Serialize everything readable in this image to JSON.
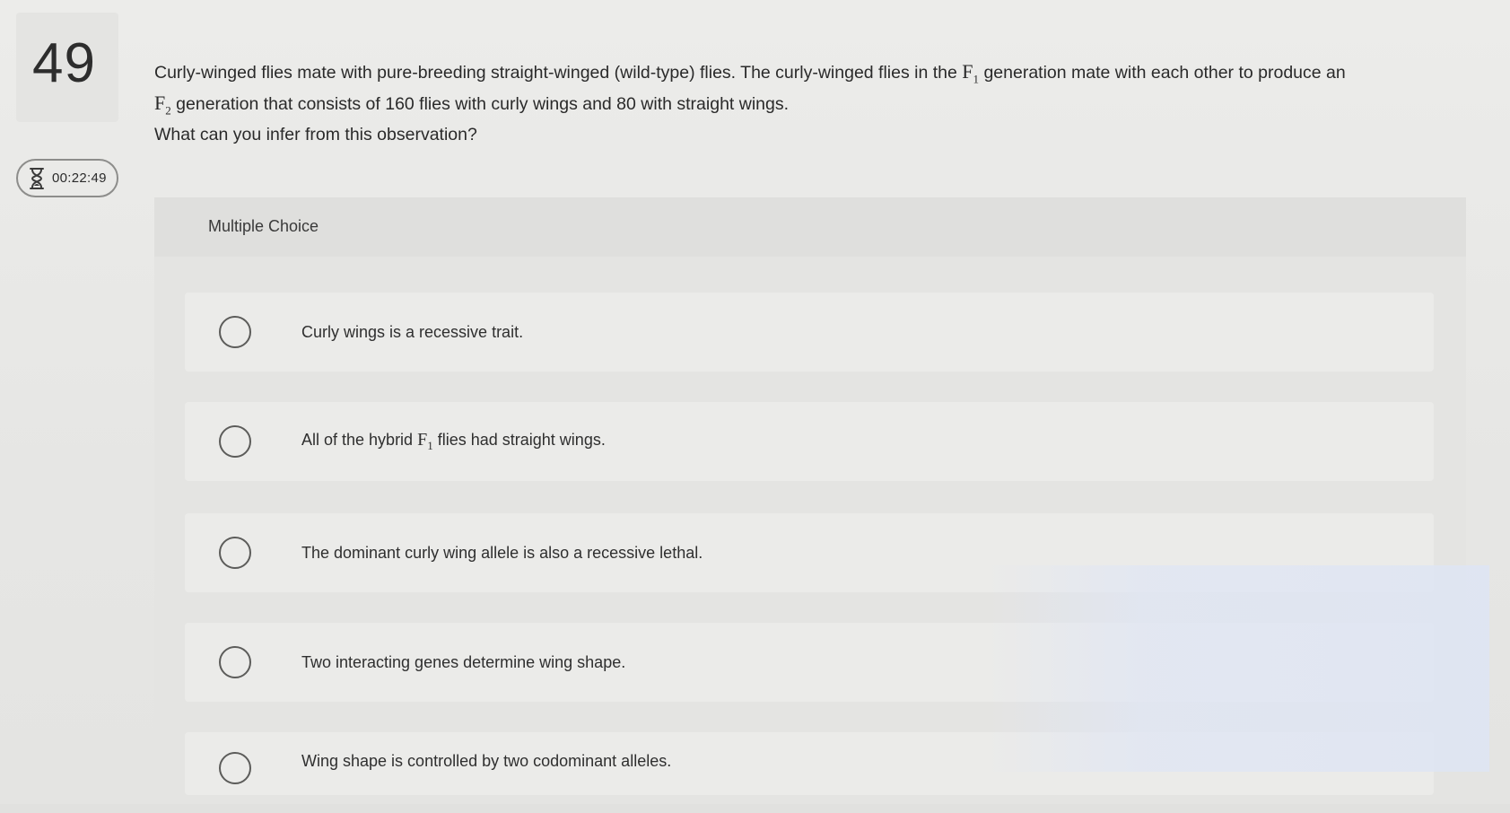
{
  "question": {
    "number": "49",
    "timer": "00:22:49",
    "prompt_line1_a": "Curly-winged flies mate with pure-breeding straight-winged (wild-type) flies. The curly-winged flies in the",
    "prompt_line1_sym": "F",
    "prompt_line1_sub": "1",
    "prompt_line1_b": "generation mate with each other to produce an",
    "prompt_line2_sym": "F",
    "prompt_line2_sub": "2",
    "prompt_line2_b": "generation that consists of 160 flies with curly wings and 80 with straight wings.",
    "prompt_line3": "What can you infer from this observation?"
  },
  "multiple_choice": {
    "title": "Multiple Choice",
    "options": [
      {
        "text": "Curly wings is a recessive trait."
      },
      {
        "text_a": "All of the hybrid",
        "sym": "F",
        "sub": "1",
        "text_b": "flies had straight wings."
      },
      {
        "text": "The dominant curly wing allele is also a recessive lethal."
      },
      {
        "text": "Two interacting genes determine wing shape."
      },
      {
        "text": "Wing shape is controlled by two codominant alleles."
      }
    ]
  },
  "icons": {
    "timer_icon": "hourglass-icon",
    "option_icon": "radio-circle-icon"
  },
  "colors": {
    "background": "#e9e9e7",
    "panel": "#e4e4e2",
    "option_row": "#ebebe9",
    "text": "#2b2b2b"
  }
}
